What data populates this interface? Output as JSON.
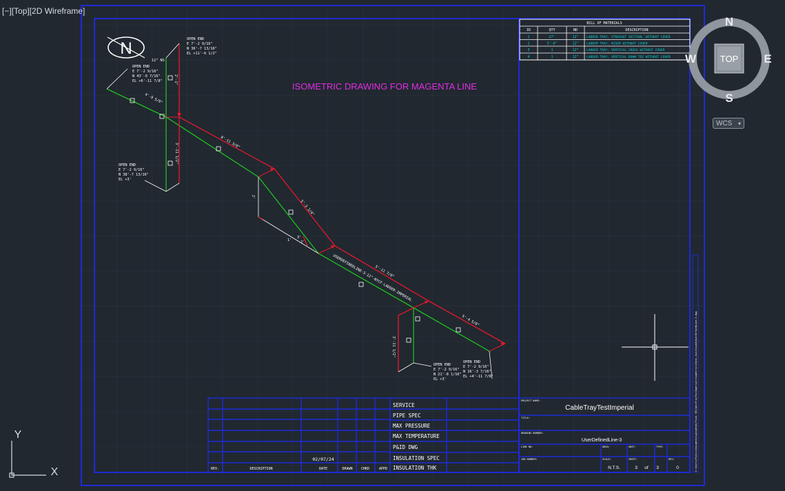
{
  "viewport": {
    "control": "[−]",
    "view": "[Top]",
    "style": "[2D Wireframe]"
  },
  "title": "ISOMETRIC DRAWING FOR MAGENTA LINE",
  "north_symbol": "N",
  "bill_of_materials": {
    "heading": "BILL OF MATERIALS",
    "columns": [
      "ID",
      "QTY",
      "ND",
      "DESCRIPTION"
    ],
    "rows": [
      [
        "1",
        "27'",
        "12\"",
        "LADDER TRAY, STRAIGHT SECTION, WITHOUT COVER"
      ],
      [
        "2",
        "3'-6\"",
        "12\"",
        "LADDER TRAY, RISER WITHOUT COVER"
      ],
      [
        "3",
        "1",
        "12\"",
        "LADDER TRAY, VERTICAL CROSS WITHOUT COVER"
      ],
      [
        "4",
        "1",
        "12\"",
        "LADDER TRAY, VERTICAL DOWN TEE WITHOUT COVER"
      ]
    ]
  },
  "annotations": {
    "open_end_1": [
      "OPEN END",
      "E 7'-2 9/16\"",
      "N 36'-7 13/16\"",
      "EL +11'-6 1/2\""
    ],
    "open_end_2": [
      "OPEN END",
      "E 7'-2 9/16\"",
      "N 43'-0 7/16\"",
      "EL +6'-11 7/8\""
    ],
    "open_end_3": [
      "OPEN END",
      "E 7'-2 9/16\"",
      "N 38'-7 13/16\"",
      "EL +3'"
    ],
    "open_end_4": [
      "OPEN END",
      "E 7'-2 9/16\"",
      "N 21'-8 1/16\"",
      "EL +3'"
    ],
    "open_end_5": [
      "OPEN END",
      "E 7'-2 9/16\"",
      "N 16'-3 7/16\"",
      "EL +4'-11 7/8\""
    ],
    "size_note": "12\" NS",
    "spec_note": "USERDEFINEDLINE-3-12\"-NYCF-LADDER-IMPERIAL"
  },
  "dimensions": {
    "d1": "4'-9 5/8\"",
    "d2": "8'-11 3/8\"",
    "d3": "5'-3 1/4\"",
    "d4": "5'-11 7/8\"",
    "d5": "5'-4 5/8\"",
    "d6": "3'-11 1/2\"",
    "d7": "3'-11 1/2\"",
    "d8": "2'-1\"",
    "d9": "2'",
    "d10": "1'",
    "d11": "3'",
    "d12": "2'"
  },
  "title_block": {
    "rev_headers": [
      "REV.",
      "DESCRIPTION",
      "DATE",
      "DRAWN",
      "CHKD",
      "APPD"
    ],
    "date_value": "02/07/24",
    "spec_labels": [
      "SERVICE",
      "PIPE SPEC",
      "MAX PRESSURE",
      "MAX TEMPERATURE",
      "P&ID DWG",
      "INSULATION SPEC",
      "INSULATION THK"
    ],
    "project_name_label": "PROJECT NAME:",
    "project_name": "CableTrayTestImperial",
    "title_label": "TITLE:",
    "drawing_number_label": "DRAWING NUMBER:",
    "drawing_number": "UserDefinedLine-3",
    "line_no_label": "LINE NO:",
    "area_label": "AREA:",
    "unit_label": "UNIT:",
    "type_label": "TYPE:",
    "job_number_label": "JOB NUMBER:",
    "scale_label": "SCALE:",
    "sheet_label": "SHEET:",
    "rev_label": "REV:",
    "scale": "N.T.S.",
    "sheet": "3",
    "of_label": "of",
    "sheet_total": "3",
    "rev": "0"
  },
  "file_path": "C:\\Users\\Public\\Documents\\Autodesk\\Plant 3D\\CableTrayTestImperial\\Isometric\\Check_Iso\\Issued\\UserDefinedLine-3.dwg",
  "viewcube": {
    "north": "N",
    "south": "S",
    "east": "E",
    "west": "W",
    "face": "TOP"
  },
  "wcs_button": "WCS",
  "ucs": {
    "x": "X",
    "y": "Y"
  },
  "colors": {
    "background": "#212830",
    "border": "#1e2bd8",
    "green_line": "#1fbf1f",
    "red_line": "#e8182b",
    "magenta_title": "#e42ce4",
    "bom_text": "#00d8d8",
    "white": "#ffffff"
  }
}
